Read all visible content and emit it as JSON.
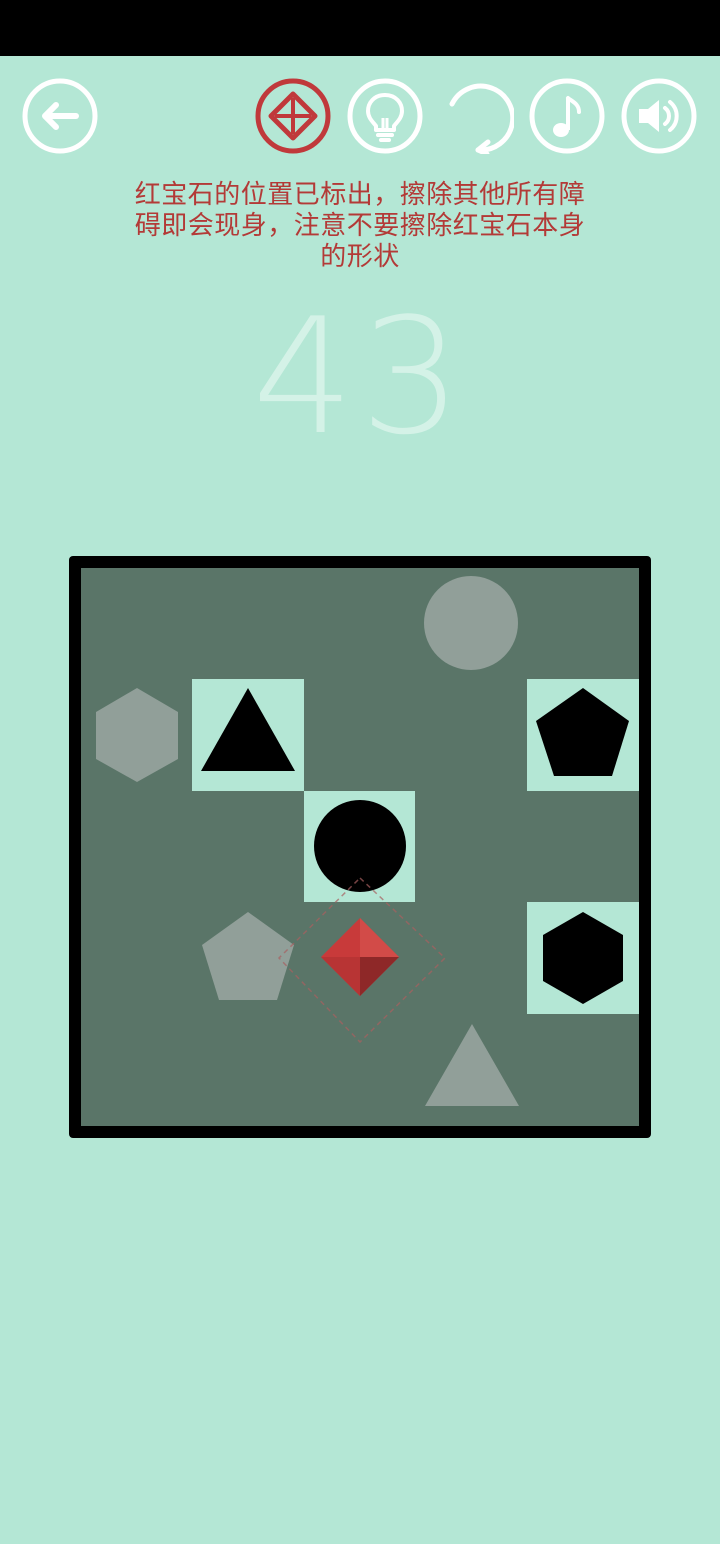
{
  "hint": {
    "lines": [
      "红宝石的位置已标出，擦除其他所有障",
      "碍即会现身，注意不要擦除红宝石本身",
      "的形状"
    ]
  },
  "counter": "43",
  "toolbar": {
    "icons": [
      "back-arrow-icon",
      "gem-locator-icon",
      "lightbulb-icon",
      "restart-icon",
      "music-note-icon",
      "speaker-icon"
    ]
  },
  "colors": {
    "background": "#b4e7d5",
    "board_fill": "#5a7568",
    "revealed_cell": "#b4e7d5",
    "ghost_shape": "#919f99",
    "active_shape": "#000000",
    "hint_red": "#b33a37",
    "gem_red": "#c83a3a",
    "counter": "#d4f2e7"
  },
  "board": {
    "grid": "5x5",
    "revealed_cells": [
      {
        "row": 1,
        "col": 1,
        "shape": "triangle"
      },
      {
        "row": 1,
        "col": 4,
        "shape": "pentagon"
      },
      {
        "row": 2,
        "col": 2,
        "shape": "circle"
      },
      {
        "row": 3,
        "col": 4,
        "shape": "hexagon"
      }
    ],
    "ghost_shapes": [
      {
        "row": 0,
        "col": 3,
        "shape": "circle"
      },
      {
        "row": 1,
        "col": 0,
        "shape": "hexagon"
      },
      {
        "row": 3,
        "col": 1,
        "shape": "pentagon"
      },
      {
        "row": 4,
        "col": 3,
        "shape": "triangle"
      }
    ],
    "gem": {
      "row": 3,
      "col": 2,
      "shape": "diamond"
    }
  }
}
